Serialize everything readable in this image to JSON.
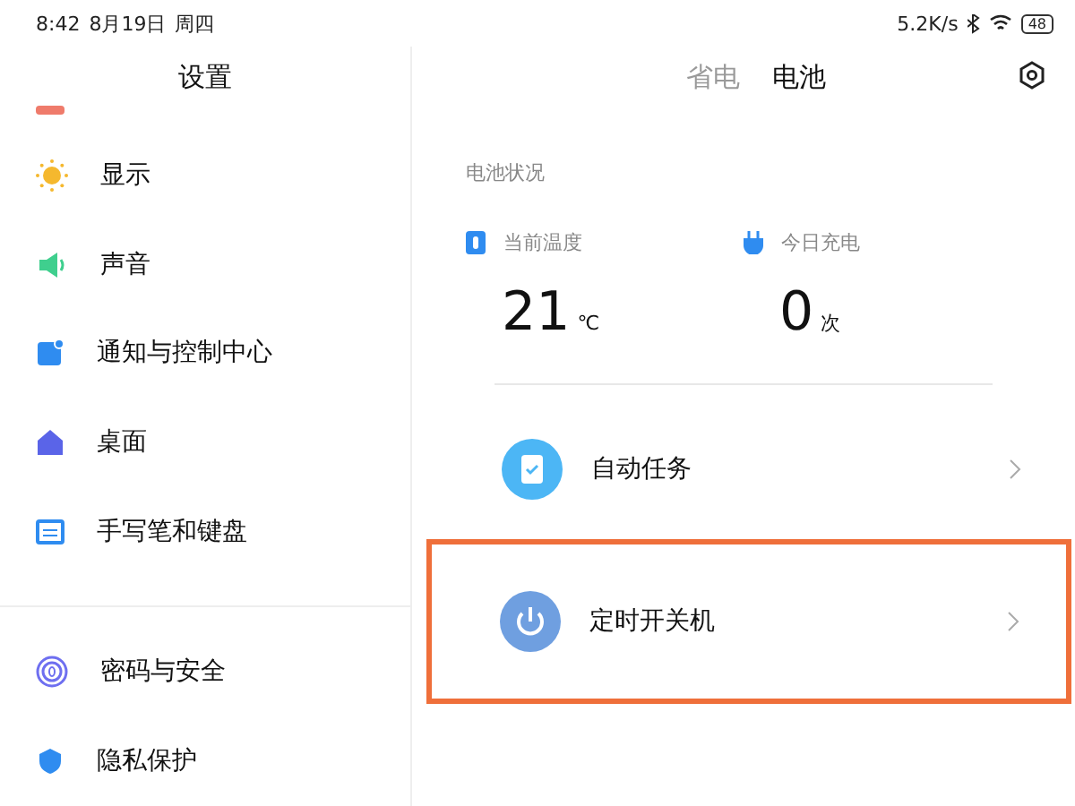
{
  "status_bar": {
    "time": "8:42",
    "date": "8月19日",
    "weekday": "周四",
    "speed": "5.2K/s",
    "battery": "48"
  },
  "sidebar": {
    "title": "设置",
    "items": [
      {
        "kind": "bar",
        "color": "#ef7b6b"
      },
      {
        "label": "显示",
        "kind": "sun",
        "color": "#f5b82e"
      },
      {
        "label": "声音",
        "kind": "speaker",
        "color": "#3fcf8e"
      },
      {
        "label": "通知与控制中心",
        "kind": "notice",
        "color": "#2f8cf0"
      },
      {
        "label": "桌面",
        "kind": "home",
        "color": "#5a64e8"
      },
      {
        "label": "手写笔和键盘",
        "kind": "keyboard",
        "color": "#2f8cf0"
      },
      {
        "label": "密码与安全",
        "kind": "fingerprint",
        "color": "#6e6ff0",
        "group_start": true
      },
      {
        "label": "隐私保护",
        "kind": "shield",
        "color": "#2f8cf0"
      }
    ]
  },
  "tabs": [
    {
      "label": "省电",
      "selected": false
    },
    {
      "label": "电池",
      "selected": true
    }
  ],
  "battery_status": {
    "title": "电池状况",
    "stats": [
      {
        "label": "当前温度",
        "value": "21",
        "unit": "℃",
        "kind": "thermo"
      },
      {
        "label": "今日充电",
        "value": "0",
        "unit": "次",
        "kind": "plug"
      }
    ]
  },
  "actions": [
    {
      "label": "自动任务",
      "kind": "clipboard",
      "highlighted": false
    },
    {
      "label": "定时开关机",
      "kind": "power",
      "highlighted": true
    }
  ]
}
